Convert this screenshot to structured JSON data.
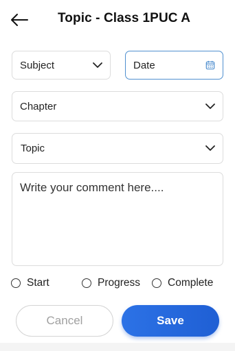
{
  "header": {
    "title": "Topic - Class 1PUC A",
    "back_icon": "arrow-left-icon"
  },
  "form": {
    "subject": {
      "label": "Subject",
      "icon": "chevron-down-icon"
    },
    "date": {
      "label": "Date",
      "icon": "calendar-icon",
      "accent": "#4f8fcf"
    },
    "chapter": {
      "label": "Chapter",
      "icon": "chevron-down-icon"
    },
    "topic": {
      "label": "Topic",
      "icon": "chevron-down-icon"
    },
    "comment": {
      "placeholder": "Write your comment here...."
    }
  },
  "status_options": [
    {
      "label": "Start",
      "selected": false
    },
    {
      "label": "Progress",
      "selected": false
    },
    {
      "label": "Complete",
      "selected": false
    }
  ],
  "actions": {
    "cancel_label": "Cancel",
    "save_label": "Save",
    "save_color": "#1f5fd4"
  }
}
